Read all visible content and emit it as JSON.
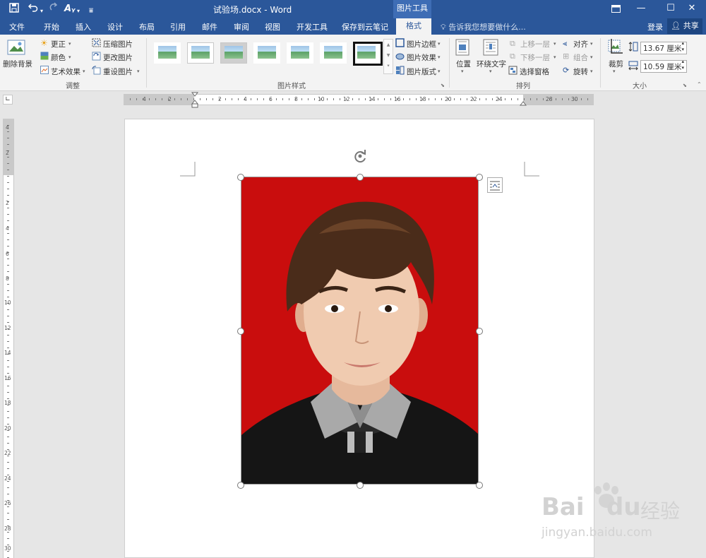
{
  "window": {
    "title": "试验场.docx - Word",
    "tool_tab": "图片工具",
    "controls": [
      "restore-ribbon",
      "minimize",
      "maximize",
      "close"
    ]
  },
  "quick_access": {
    "save": "save",
    "undo": "undo",
    "redo": "redo",
    "format_painter": "Aᵧ"
  },
  "tabs": [
    "文件",
    "开始",
    "插入",
    "设计",
    "布局",
    "引用",
    "邮件",
    "审阅",
    "视图",
    "开发工具",
    "保存到云笔记",
    "格式"
  ],
  "active_tab": "格式",
  "tell_me": "告诉我您想要做什么...",
  "login": "登录",
  "share": "共享",
  "ribbon": {
    "remove_bg": "删除背景",
    "adjust": {
      "corrections": "更正",
      "color": "颜色",
      "artistic": "艺术效果",
      "compress": "压缩图片",
      "change": "更改图片",
      "reset": "重设图片",
      "label": "调整"
    },
    "styles": {
      "label": "图片样式",
      "border": "图片边框",
      "effects": "图片效果",
      "layout": "图片版式"
    },
    "arrange": {
      "position": "位置",
      "wrap": "环绕文字",
      "forward": "上移一层",
      "backward": "下移一层",
      "selection_pane": "选择窗格",
      "align": "对齐",
      "group": "组合",
      "rotate": "旋转",
      "label": "排列"
    },
    "size": {
      "crop": "裁剪",
      "height": "13.67 厘米",
      "width": "10.59 厘米",
      "label": "大小"
    }
  },
  "ruler": {
    "h_numbers": [
      "4",
      "2",
      "2",
      "4",
      "6",
      "8",
      "10",
      "12",
      "14",
      "16",
      "18",
      "20",
      "22",
      "24",
      "28",
      "30"
    ],
    "v_numbers": [
      "4",
      "2",
      "2",
      "4",
      "6",
      "8",
      "10",
      "12",
      "14",
      "16",
      "18",
      "20",
      "22",
      "24",
      "26",
      "28",
      "30"
    ]
  },
  "watermark": {
    "brand": "Bai",
    "brand2": "du",
    "cn": "经验",
    "url": "jingyan.baidu.com"
  },
  "colors": {
    "accent": "#2b579a",
    "photo_bg": "#c90d0d"
  }
}
